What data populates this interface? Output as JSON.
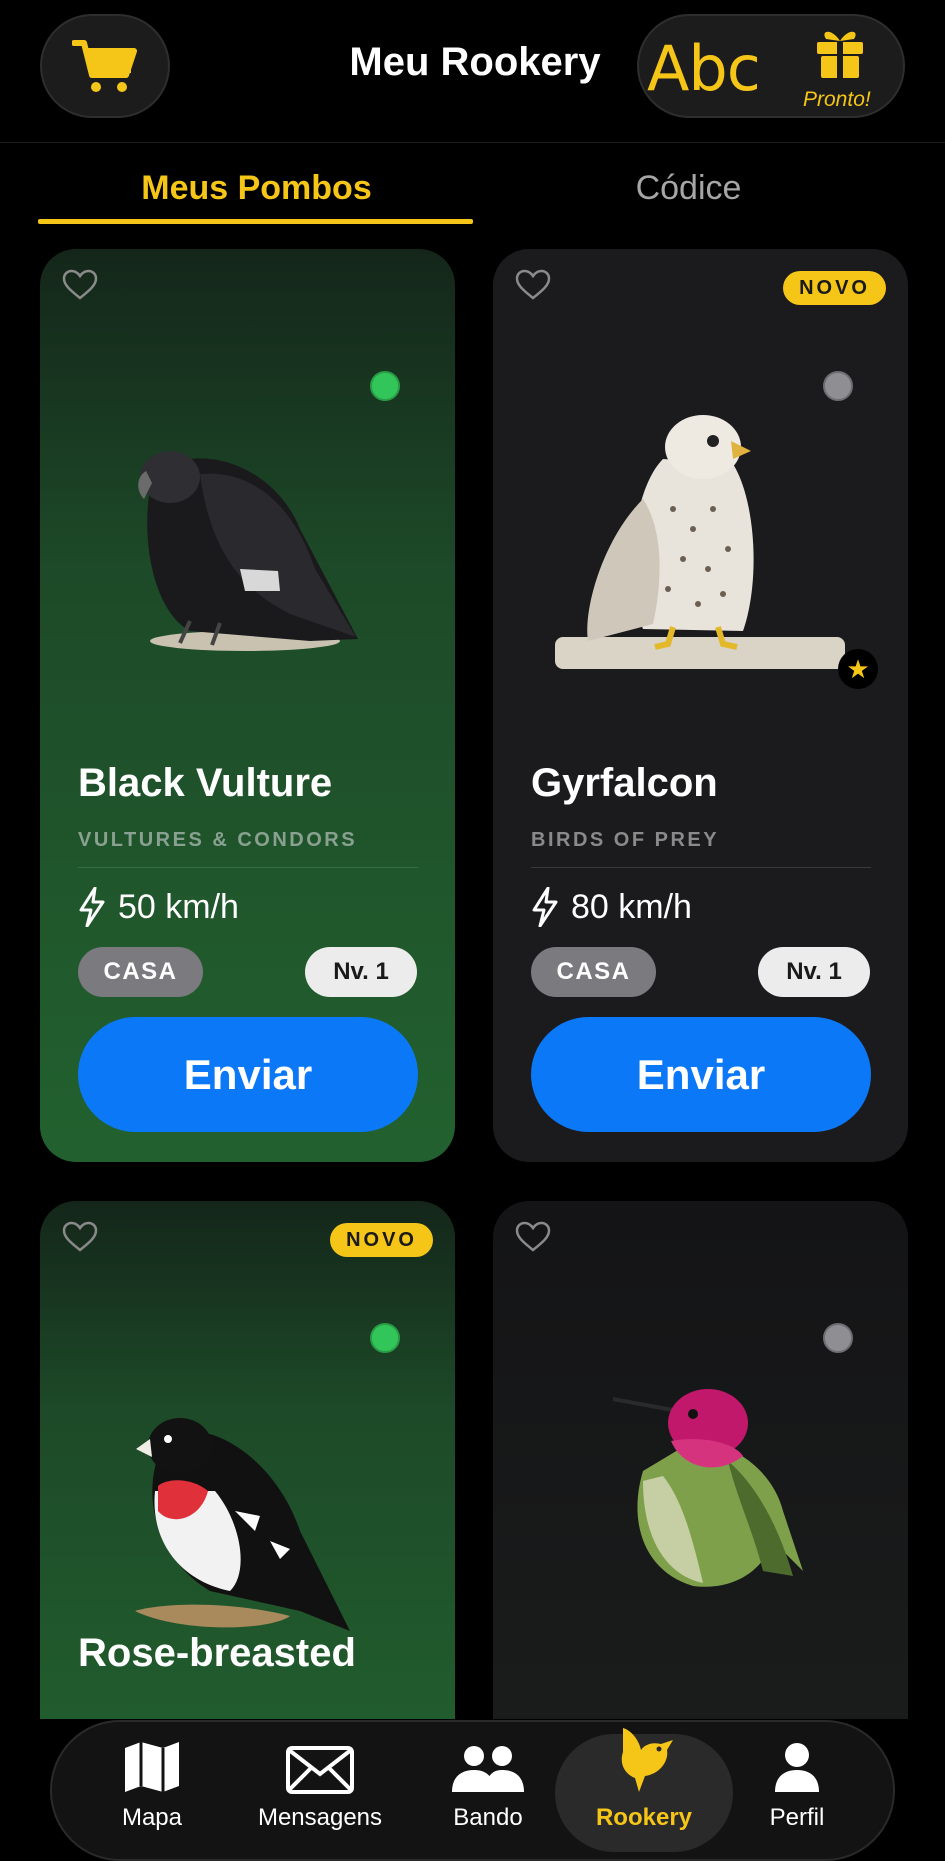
{
  "header": {
    "title": "Meu Rookery",
    "cart_icon": "shopping-cart-icon",
    "letters": "Abc",
    "gift_icon": "gift-icon",
    "gift_status": "Pronto!"
  },
  "tabs": [
    {
      "label": "Meus Pombos",
      "active": true
    },
    {
      "label": "Códice",
      "active": false
    }
  ],
  "cards": [
    {
      "name": "Black Vulture",
      "category": "VULTURES & CONDORS",
      "speed": "50 km/h",
      "location": "CASA",
      "level": "Nv. 1",
      "action": "Enviar",
      "is_new": false,
      "online": true,
      "favorite_star": false,
      "badge": ""
    },
    {
      "name": "Gyrfalcon",
      "category": "BIRDS OF PREY",
      "speed": "80 km/h",
      "location": "CASA",
      "level": "Nv. 1",
      "action": "Enviar",
      "is_new": true,
      "online": false,
      "favorite_star": true,
      "badge": "NOVO"
    },
    {
      "name": "Rose-breasted",
      "is_new": true,
      "online": true,
      "badge": "NOVO"
    },
    {
      "name": "",
      "is_new": false,
      "online": false,
      "badge": ""
    }
  ],
  "nav": [
    {
      "label": "Mapa",
      "icon": "map-icon",
      "active": false
    },
    {
      "label": "Mensagens",
      "icon": "envelope-icon",
      "active": false
    },
    {
      "label": "Bando",
      "icon": "group-icon",
      "active": false
    },
    {
      "label": "Rookery",
      "icon": "bird-icon",
      "active": true
    },
    {
      "label": "Perfil",
      "icon": "person-icon",
      "active": false
    }
  ],
  "colors": {
    "accent": "#f5c518",
    "primary_button": "#0b79f7",
    "online": "#32c65a",
    "offline": "#8e8e93"
  }
}
